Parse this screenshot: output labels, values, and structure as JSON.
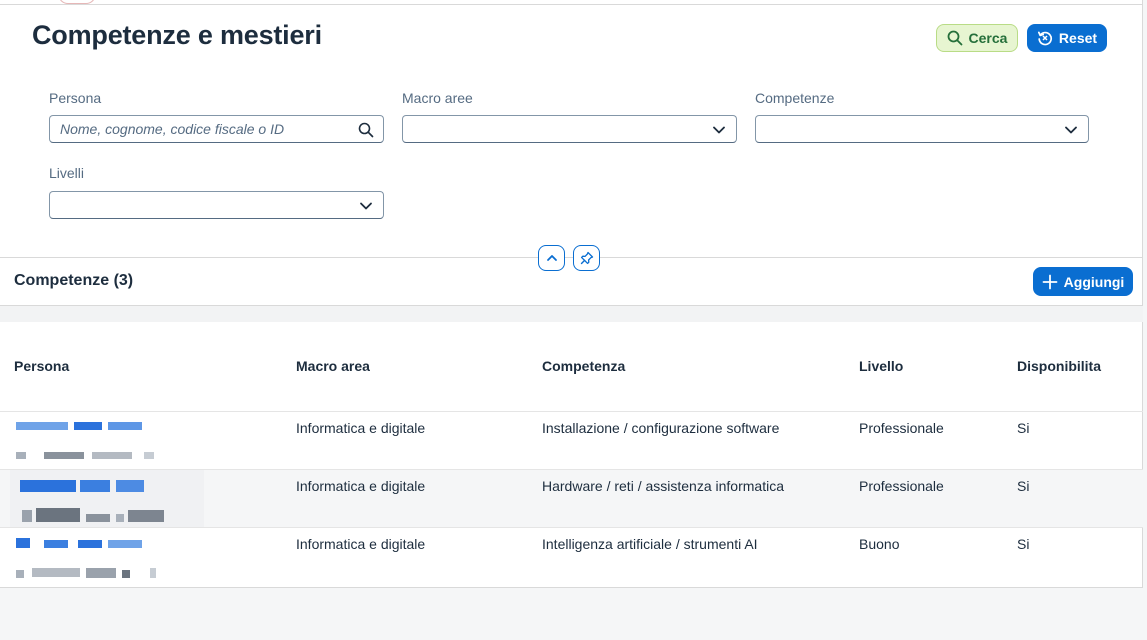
{
  "page": {
    "title": "Competenze e mestieri"
  },
  "toolbar": {
    "search_label": "Cerca",
    "reset_label": "Reset"
  },
  "filters": {
    "persona": {
      "label": "Persona",
      "placeholder": "Nome, cognome, codice fiscale o ID",
      "value": ""
    },
    "macro_aree": {
      "label": "Macro aree",
      "value": ""
    },
    "competenze": {
      "label": "Competenze",
      "value": ""
    },
    "livelli": {
      "label": "Livelli",
      "value": ""
    }
  },
  "table": {
    "title": "Competenze (3)",
    "add_label": "Aggiungi",
    "columns": [
      "Persona",
      "Macro area",
      "Competenza",
      "Livello",
      "Disponibilita"
    ],
    "rows": [
      {
        "macro_area": "Informatica e digitale",
        "competenza": "Installazione / configurazione software",
        "livello": "Professionale",
        "disponibilita": "Si"
      },
      {
        "macro_area": "Informatica e digitale",
        "competenza": "Hardware / reti / assistenza informatica",
        "livello": "Professionale",
        "disponibilita": "Si"
      },
      {
        "macro_area": "Informatica e digitale",
        "competenza": "Intelligenza artificiale / strumenti AI",
        "livello": "Buono",
        "disponibilita": "Si"
      }
    ]
  },
  "icons": {
    "search": "search-icon",
    "reset": "reset-icon",
    "dropdown": "chevron-down-icon",
    "collapse": "chevron-up-icon",
    "pin": "pin-icon",
    "add": "plus-icon"
  },
  "colors": {
    "accent": "#0a6ed1",
    "search_bg": "#e7f5d1",
    "search_text": "#256f3a",
    "text": "#1d2d3e"
  }
}
